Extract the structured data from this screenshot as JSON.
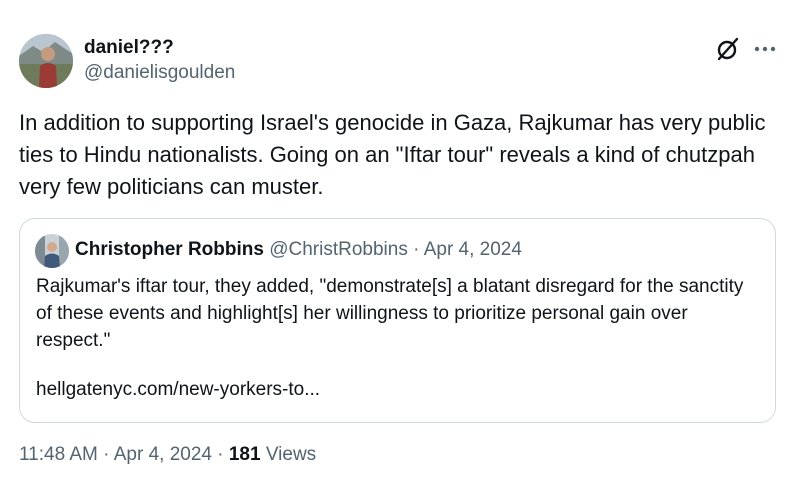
{
  "author": {
    "name": "daniel???",
    "handle": "@danielisgoulden"
  },
  "tweet": {
    "text": "In addition to supporting Israel's genocide in Gaza, Rajkumar has very public ties to Hindu nationalists. Going on an \"Iftar tour\" reveals a kind of chutzpah very few politicians can muster."
  },
  "quote": {
    "name": "Christopher Robbins",
    "handle": "@ChristRobbins",
    "separator": " · ",
    "date": "Apr 4, 2024",
    "text": "Rajkumar's iftar tour, they added, \"demonstrate[s] a blatant disregard for the sanctity of these events and highlight[s] her willingness to prioritize personal gain over respect.\"",
    "link": "hellgatenyc.com/new-yorkers-to..."
  },
  "footer": {
    "time": "11:48 AM",
    "separator": " · ",
    "date": "Apr 4, 2024",
    "views_count": "181",
    "views_label": "Views"
  },
  "icons": {
    "grok": "grok-icon",
    "more": "more-icon"
  },
  "colors": {
    "text": "#0f1419",
    "secondary": "#536471",
    "border": "#cfd9de"
  }
}
